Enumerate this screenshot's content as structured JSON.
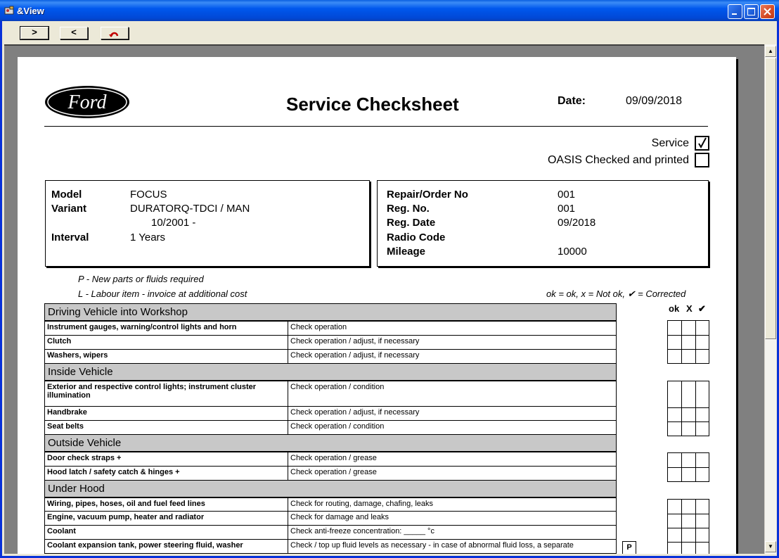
{
  "window": {
    "title": "&View"
  },
  "toolbar": {
    "next": ">",
    "prev": "<"
  },
  "doc": {
    "title": "Service Checksheet",
    "date_label": "Date:",
    "date_value": "09/09/2018",
    "logo_text": "Ford",
    "service_label": "Service",
    "service_checked": true,
    "oasis_label": "OASIS Checked and printed",
    "oasis_checked": false
  },
  "vehicle": {
    "model_label": "Model",
    "model": "FOCUS",
    "variant_label": "Variant",
    "variant": "DURATORQ-TDCI / MAN",
    "variant_date": "10/2001 -",
    "interval_label": "Interval",
    "interval": "1 Years"
  },
  "order": {
    "repair_label": "Repair/Order No",
    "repair": "001",
    "reg_label": "Reg. No.",
    "reg": "001",
    "regdate_label": "Reg. Date",
    "regdate": "09/2018",
    "radio_label": "Radio Code",
    "radio": "",
    "mileage_label": "Mileage",
    "mileage": "10000"
  },
  "legend": {
    "p": "P  -  New parts or fluids required",
    "l": "L  -  Labour item - invoice at additional cost",
    "ok": "ok = ok,      x = Not ok,   ✔ = Corrected"
  },
  "columns": {
    "ok": "ok",
    "x": "X",
    "corrected": "✔"
  },
  "sections": [
    {
      "title": "Driving Vehicle into Workshop",
      "rows": [
        {
          "item": "Instrument gauges, warning/control lights and horn",
          "action": "Check operation"
        },
        {
          "item": "Clutch",
          "action": "Check operation / adjust, if necessary"
        },
        {
          "item": "Washers, wipers",
          "action": "Check operation / adjust, if necessary"
        }
      ]
    },
    {
      "title": "Inside Vehicle",
      "rows": [
        {
          "item": "Exterior and respective control lights; instrument cluster illumination",
          "action": "Check operation / condition"
        },
        {
          "item": "Handbrake",
          "action": "Check operation / adjust, if necessary"
        },
        {
          "item": "Seat belts",
          "action": "Check operation / condition"
        }
      ]
    },
    {
      "title": "Outside Vehicle",
      "rows": [
        {
          "item": "Door check straps +",
          "action": "Check operation / grease"
        },
        {
          "item": "Hood latch / safety catch & hinges +",
          "action": "Check operation / grease"
        }
      ]
    },
    {
      "title": "Under Hood",
      "rows": [
        {
          "item": "Wiring, pipes, hoses, oil and fuel feed lines",
          "action": "Check for routing, damage, chafing, leaks"
        },
        {
          "item": "Engine, vacuum pump, heater and radiator",
          "action": "Check for damage and leaks"
        },
        {
          "item": "Coolant",
          "action": "Check anti-freeze concentration: _____   °c"
        },
        {
          "item": "Coolant expansion tank, power steering fluid, washer",
          "action": "Check / top up fluid levels as necessary - in case of abnormal fluid loss, a separate"
        }
      ]
    }
  ],
  "p_marker": "P"
}
